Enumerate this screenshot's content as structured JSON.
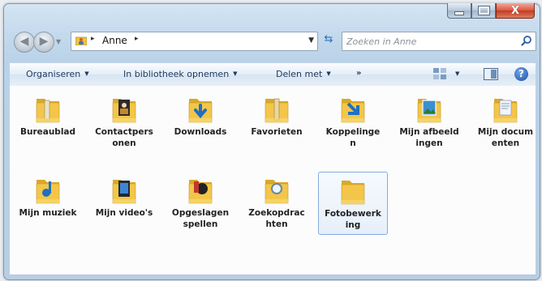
{
  "window": {
    "caption_buttons": [
      "minimize-icon",
      "maximize-icon",
      "close-icon"
    ],
    "close_glyph": "X"
  },
  "navigation": {
    "back_glyph": "◀",
    "forward_glyph": "▶"
  },
  "address": {
    "crumb": "Anne",
    "separator": "▸"
  },
  "search": {
    "placeholder": "Zoeken in Anne"
  },
  "toolbar": {
    "organize": "Organiseren",
    "library": "In bibliotheek opnemen",
    "share": "Delen met",
    "more": "»",
    "help": "?"
  },
  "items": [
    {
      "label": "Bureaublad",
      "icon": "desktop-folder-icon"
    },
    {
      "label": "Contactpersonen",
      "icon": "contacts-folder-icon"
    },
    {
      "label": "Downloads",
      "icon": "downloads-folder-icon"
    },
    {
      "label": "Favorieten",
      "icon": "favorites-folder-icon"
    },
    {
      "label": "Koppelingen",
      "icon": "links-folder-icon"
    },
    {
      "label": "Mijn afbeeldingen",
      "icon": "pictures-folder-icon"
    },
    {
      "label": "Mijn documenten",
      "icon": "documents-folder-icon"
    },
    {
      "label": "Mijn muziek",
      "icon": "music-folder-icon"
    },
    {
      "label": "Mijn video's",
      "icon": "videos-folder-icon"
    },
    {
      "label": "Opgeslagen spellen",
      "icon": "saved-games-folder-icon"
    },
    {
      "label": "Zoekopdrachten",
      "icon": "searches-folder-icon"
    },
    {
      "label": "Fotobewerking",
      "icon": "folder-icon",
      "selected": true
    }
  ],
  "colors": {
    "folder": "#f3c64a",
    "accent": "#1e395b",
    "selection_border": "#84acdd"
  }
}
